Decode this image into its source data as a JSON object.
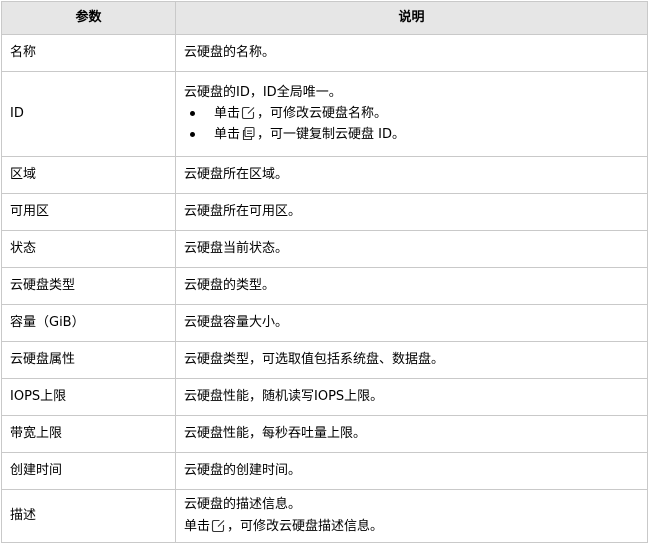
{
  "table": {
    "headers": [
      "参数",
      "说明"
    ],
    "rows": [
      {
        "param": "名称",
        "desc": "云硬盘的名称。"
      },
      {
        "param": "ID",
        "desc_line1": "云硬盘的ID，ID全局唯一。",
        "bullets": [
          {
            "prefix": "单击",
            "icon": "edit-icon",
            "suffix": "，可修改云硬盘名称。"
          },
          {
            "prefix": "单击",
            "icon": "copy-icon",
            "suffix": "，可一键复制云硬盘 ID。"
          }
        ]
      },
      {
        "param": "区域",
        "desc": "云硬盘所在区域。"
      },
      {
        "param": "可用区",
        "desc": "云硬盘所在可用区。"
      },
      {
        "param": "状态",
        "desc": "云硬盘当前状态。"
      },
      {
        "param": "云硬盘类型",
        "desc": "云硬盘的类型。"
      },
      {
        "param": "容量（GiB）",
        "desc": "云硬盘容量大小。"
      },
      {
        "param": "云硬盘属性",
        "desc": "云硬盘类型，可选取值包括系统盘、数据盘。"
      },
      {
        "param": "IOPS上限",
        "desc": "云硬盘性能，随机读写IOPS上限。"
      },
      {
        "param": "带宽上限",
        "desc": "云硬盘性能，每秒吞吐量上限。"
      },
      {
        "param": "创建时间",
        "desc": "云硬盘的创建时间。"
      },
      {
        "param": "描述",
        "desc_line1": "云硬盘的描述信息。",
        "line2": {
          "prefix": "单击",
          "icon": "edit-icon",
          "suffix": "，可修改云硬盘描述信息。"
        }
      }
    ]
  }
}
